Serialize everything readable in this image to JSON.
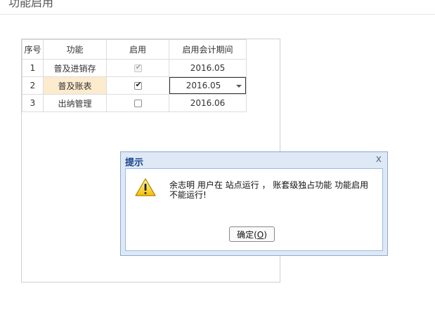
{
  "page": {
    "title": "功能启用"
  },
  "table": {
    "headers": {
      "index": "序号",
      "function": "功能",
      "enabled": "启用",
      "period": "启用会计期间"
    },
    "rows": [
      {
        "index": "1",
        "function": "普及进销存",
        "enabled": true,
        "enabled_state": "checked-disabled",
        "period": "2016.05"
      },
      {
        "index": "2",
        "function": "普及账表",
        "enabled": true,
        "enabled_state": "checked",
        "period": "2016.05",
        "selected": true
      },
      {
        "index": "3",
        "function": "出纳管理",
        "enabled": false,
        "enabled_state": "unchecked",
        "period": "2016.06"
      }
    ]
  },
  "dialog": {
    "title": "提示",
    "close_glyph": "x",
    "message": "余志明 用户在 站点运行 ， 账套级独占功能 功能启用 不能运行!",
    "ok_label": "确定",
    "ok_hotkey": "O",
    "icon": "warning-icon"
  },
  "colors": {
    "selected_row_bg": "#fdebcd",
    "dialog_frame": "#dfe8f5",
    "dialog_title": "#15428b"
  }
}
